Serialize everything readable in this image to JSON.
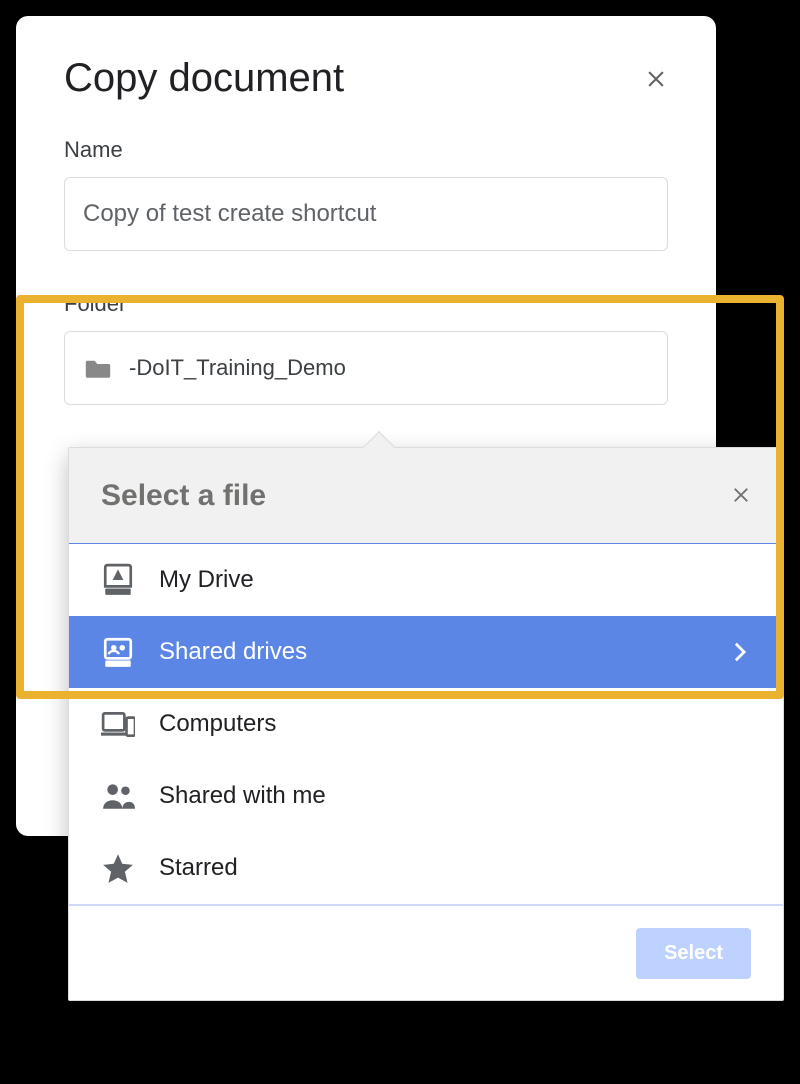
{
  "dialog": {
    "title": "Copy document",
    "nameLabel": "Name",
    "nameValue": "Copy of test create shortcut",
    "folderLabel": "Folder",
    "folderValue": "-DoIT_Training_Demo"
  },
  "picker": {
    "title": "Select a file",
    "selectLabel": "Select",
    "items": [
      {
        "label": "My Drive",
        "icon": "drive",
        "selected": false,
        "hasChevron": false
      },
      {
        "label": "Shared drives",
        "icon": "shared-drive",
        "selected": true,
        "hasChevron": true
      },
      {
        "label": "Computers",
        "icon": "devices",
        "selected": false,
        "hasChevron": false
      },
      {
        "label": "Shared with me",
        "icon": "people",
        "selected": false,
        "hasChevron": false
      },
      {
        "label": "Starred",
        "icon": "star",
        "selected": false,
        "hasChevron": false
      }
    ]
  }
}
